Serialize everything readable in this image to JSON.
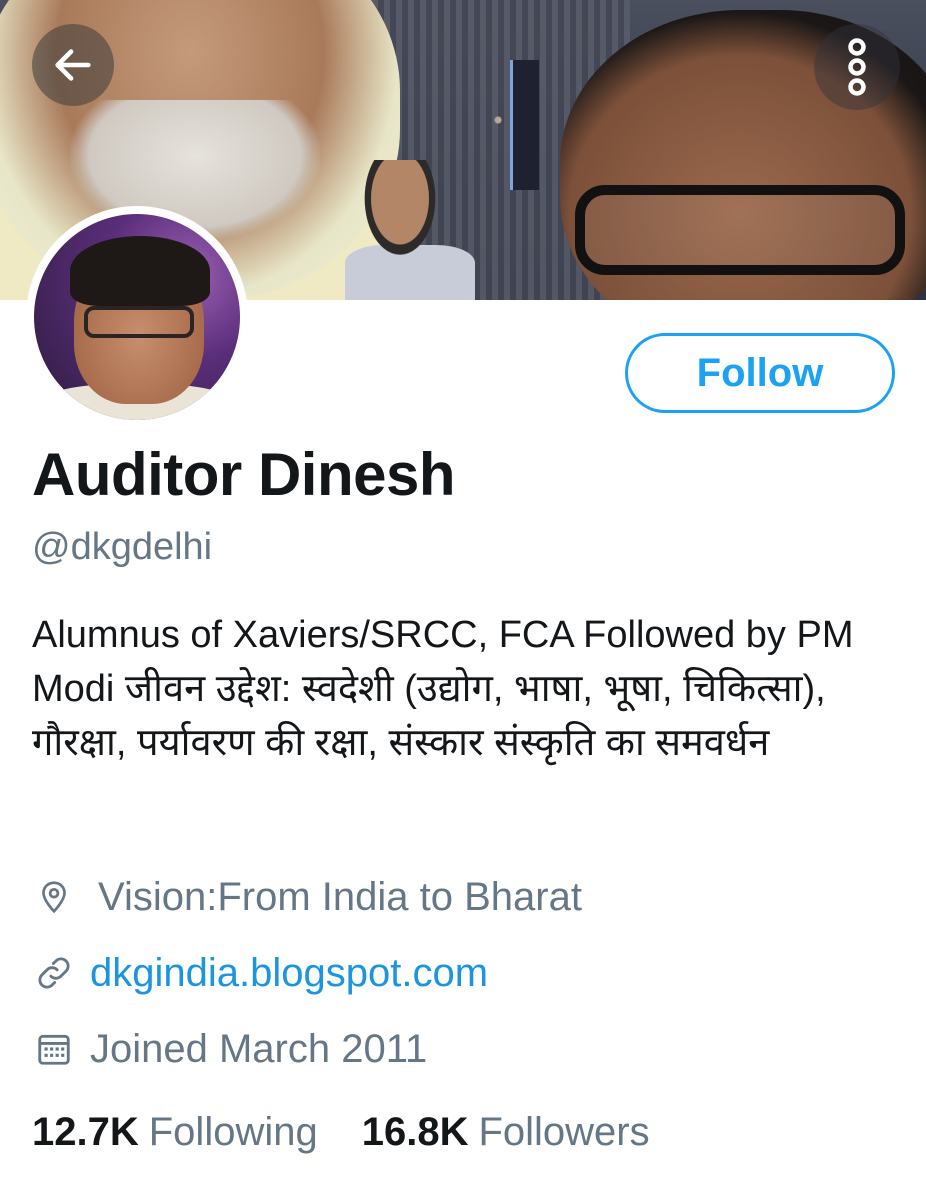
{
  "profile": {
    "name": "Auditor Dinesh",
    "handle": "@dkgdelhi",
    "bio": "Alumnus of Xaviers/SRCC, FCA Followed by PM Modi जीवन उद्देश: स्वदेशी (उद्योग, भाषा, भूषा, चिकित्सा), गौरक्षा, पर्यावरण की रक्षा, संस्कार संस्कृति का समवर्धन",
    "location": "Vision:From India to Bharat",
    "website": "dkgindia.blogspot.com",
    "joined": "Joined March 2011"
  },
  "actions": {
    "follow_label": "Follow"
  },
  "stats": {
    "following_count": "12.7K",
    "following_label": "Following",
    "followers_count": "16.8K",
    "followers_label": "Followers"
  },
  "icons": {
    "back": "arrow-left-icon",
    "more": "more-vertical-icon",
    "location": "location-pin-icon",
    "link": "link-icon",
    "calendar": "calendar-icon"
  },
  "colors": {
    "accent": "#1da1f2",
    "link": "#1b95e0",
    "secondary_text": "#657786",
    "primary_text": "#14171a"
  }
}
